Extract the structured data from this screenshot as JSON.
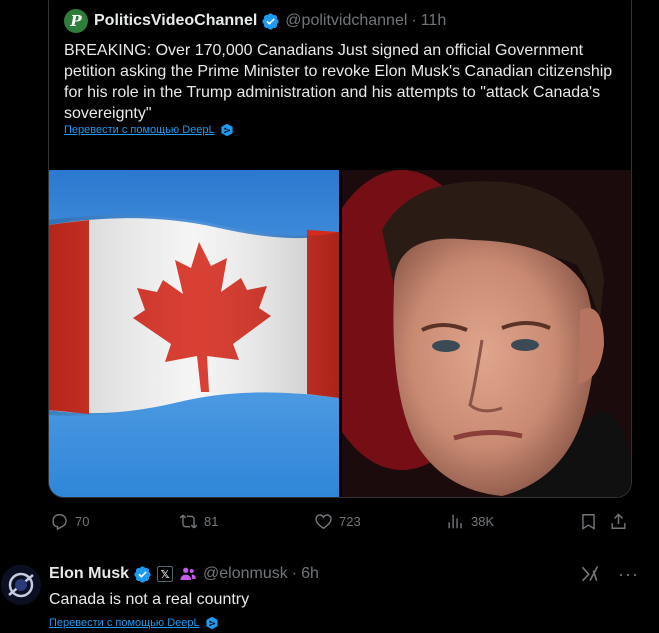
{
  "quoted_tweet": {
    "avatar_letter": "P",
    "display_name": "PoliticsVideoChannel",
    "handle": "@politvidchannel",
    "separator": "·",
    "time": "11h",
    "text": "BREAKING: Over 170,000 Canadians Just signed an official Government petition asking the Prime Minister to revoke Elon Musk's Canadian citizenship for his role in the Trump administration and his attempts to \"attack Canada's sovereignty\"",
    "translate_label": "Перевести с помощью DeepL",
    "media": [
      "canadian-flag-image",
      "portrait-photo"
    ]
  },
  "actions": {
    "replies": "70",
    "reposts": "81",
    "likes": "723",
    "views": "38K"
  },
  "reply_tweet": {
    "display_name": "Elon Musk",
    "x_badge": "𝕏",
    "handle": "@elonmusk",
    "separator": "·",
    "time": "6h",
    "text": "Canada is not a real country",
    "translate_label": "Перевести с помощью DeepL",
    "more_label": "···"
  },
  "colors": {
    "background": "#000000",
    "text_primary": "#e7e9ea",
    "text_secondary": "#71767b",
    "accent": "#1d9bf0",
    "border": "#2f3336",
    "flag_red": "#d52b1e"
  }
}
